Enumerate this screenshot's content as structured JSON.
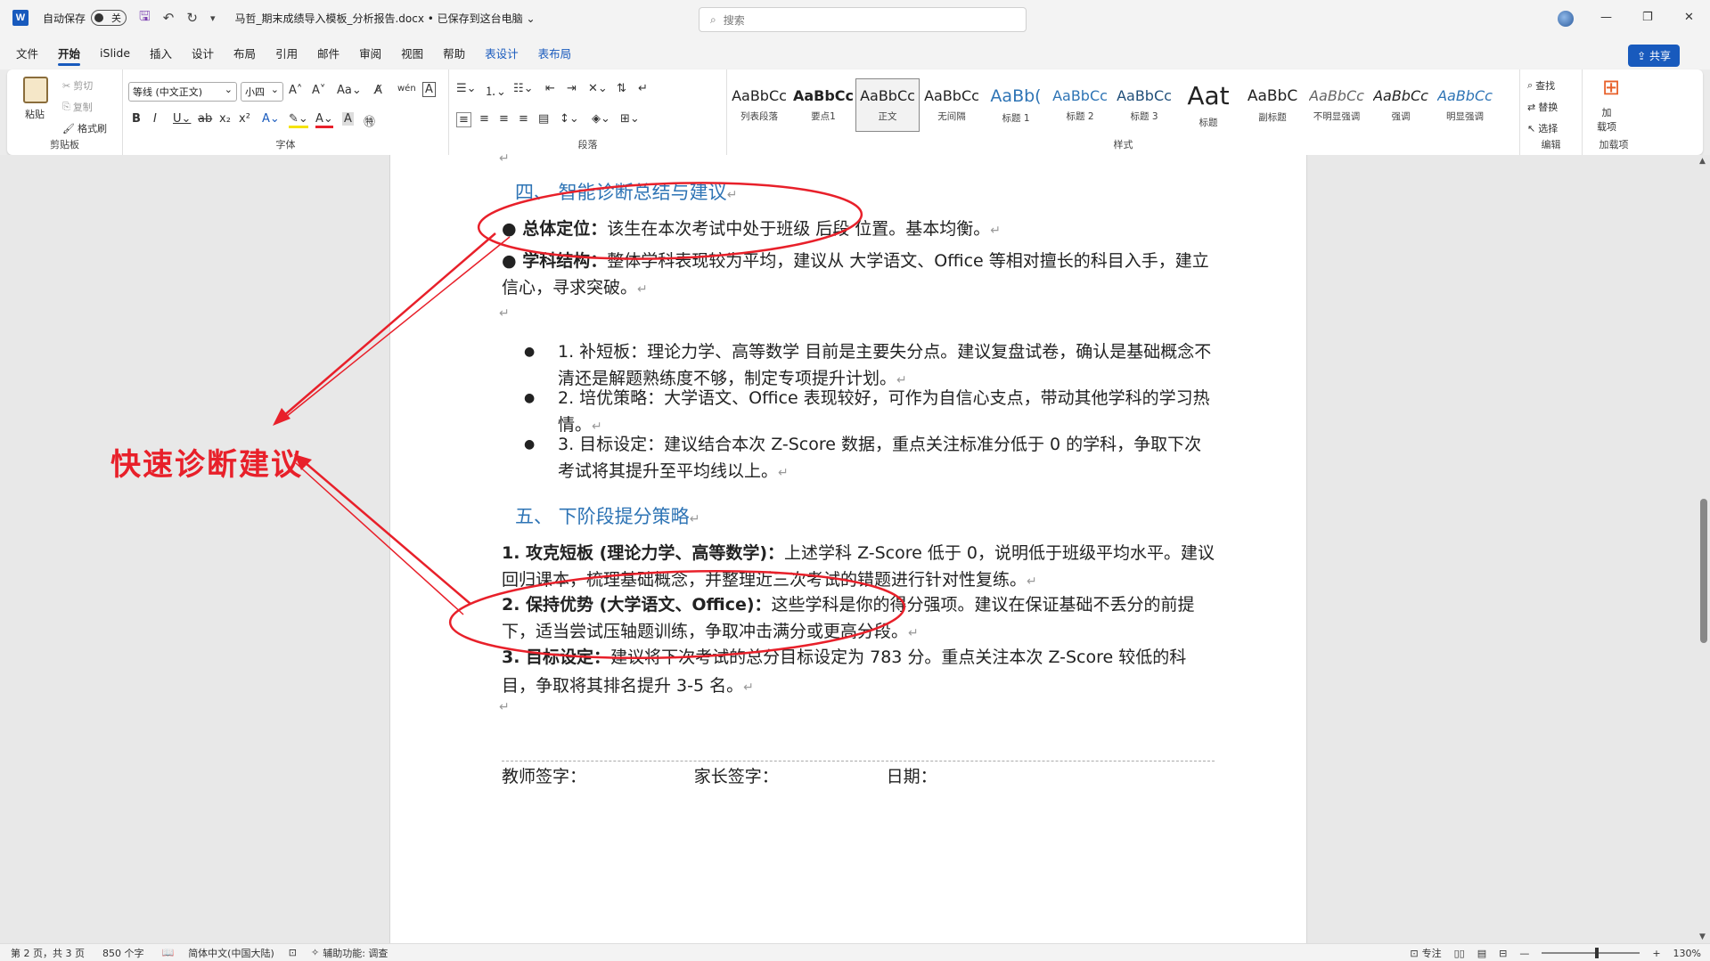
{
  "titlebar": {
    "app_logo": "W",
    "autosave_label": "自动保存",
    "autosave_state": "关",
    "doc_title": "马哲_期末成绩导入模板_分析报告.docx • 已保存到这台电脑 ⌄",
    "search_placeholder": "搜索"
  },
  "tabs": [
    "文件",
    "开始",
    "iSlide",
    "插入",
    "设计",
    "布局",
    "引用",
    "邮件",
    "审阅",
    "视图",
    "帮助"
  ],
  "context_tabs": [
    "表设计",
    "表布局"
  ],
  "share_label": "共享",
  "ribbon": {
    "clipboard": {
      "label": "剪贴板",
      "paste": "粘贴",
      "cut": "剪切",
      "copy": "复制",
      "format_painter": "格式刷"
    },
    "font": {
      "label": "字体",
      "font_name": "等线 (中文正文)",
      "font_size": "小四"
    },
    "paragraph": {
      "label": "段落"
    },
    "styles": {
      "label": "样式",
      "items": [
        {
          "sample": "AaBbCc",
          "name": "列表段落"
        },
        {
          "sample": "AaBbCc",
          "name": "要点1"
        },
        {
          "sample": "AaBbCc",
          "name": "正文"
        },
        {
          "sample": "AaBbCc",
          "name": "无间隔"
        },
        {
          "sample": "AaBb(",
          "name": "标题 1"
        },
        {
          "sample": "AaBbCc",
          "name": "标题 2"
        },
        {
          "sample": "AaBbCc",
          "name": "标题 3"
        },
        {
          "sample": "Aat",
          "name": "标题"
        },
        {
          "sample": "AaBbC",
          "name": "副标题"
        },
        {
          "sample": "AaBbCc",
          "name": "不明显强调"
        },
        {
          "sample": "AaBbCc",
          "name": "强调"
        },
        {
          "sample": "AaBbCc",
          "name": "明显强调"
        }
      ]
    },
    "editing": {
      "label": "编辑",
      "find": "查找",
      "replace": "替换",
      "select": "选择"
    },
    "addins": {
      "label": "加载项",
      "button": "加\n载项"
    }
  },
  "document": {
    "heading4": "四、 智能诊断总结与建议",
    "overall_label": "● 总体定位：",
    "overall_text": "该生在本次考试中处于班级 后段 位置。基本均衡。",
    "structure_label": "● 学科结构：",
    "structure_text": "整体学科表现较为平均，建议从 大学语文、Office 等相对擅长的科目入手，建立信心，寻求突破。",
    "list_items": [
      "1. 补短板：理论力学、高等数学 目前是主要失分点。建议复盘试卷，确认是基础概念不清还是解题熟练度不够，制定专项提升计划。",
      "2. 培优策略：大学语文、Office 表现较好，可作为自信心支点，带动其他学科的学习热情。",
      "3. 目标设定：建议结合本次 Z-Score 数据，重点关注标准分低于 0 的学科，争取下次考试将其提升至平均线以上。"
    ],
    "heading5": "五、 下阶段提分策略",
    "strategies": [
      {
        "label": "1. 攻克短板 (理论力学、高等数学)：",
        "text": "上述学科 Z-Score 低于 0，说明低于班级平均水平。建议回归课本，梳理基础概念，并整理近三次考试的错题进行针对性复练。"
      },
      {
        "label": "2. 保持优势 (大学语文、Office)：",
        "text": "这些学科是你的得分强项。建议在保证基础不丢分的前提下，适当尝试压轴题训练，争取冲击满分或更高分段。"
      },
      {
        "label": "3. 目标设定：",
        "text": "建议将下次考试的总分目标设定为 783 分。重点关注本次 Z-Score 较低的科目，争取将其排名提升 3-5 名。"
      }
    ],
    "sign_row": "教师签字：                    家长签字：                    日期："
  },
  "annotation": {
    "label": "快速诊断建议",
    "color": "#e8202a"
  },
  "statusbar": {
    "page": "第 2 页，共 3 页",
    "words": "850 个字",
    "language": "简体中文(中国大陆)",
    "accessibility": "辅助功能: 调查",
    "focus": "专注",
    "zoom": "130%",
    "zoom_fraction": 0.56
  },
  "colors": {
    "accent": "#185abd",
    "heading": "#2e74b5",
    "annotation": "#e8202a"
  }
}
